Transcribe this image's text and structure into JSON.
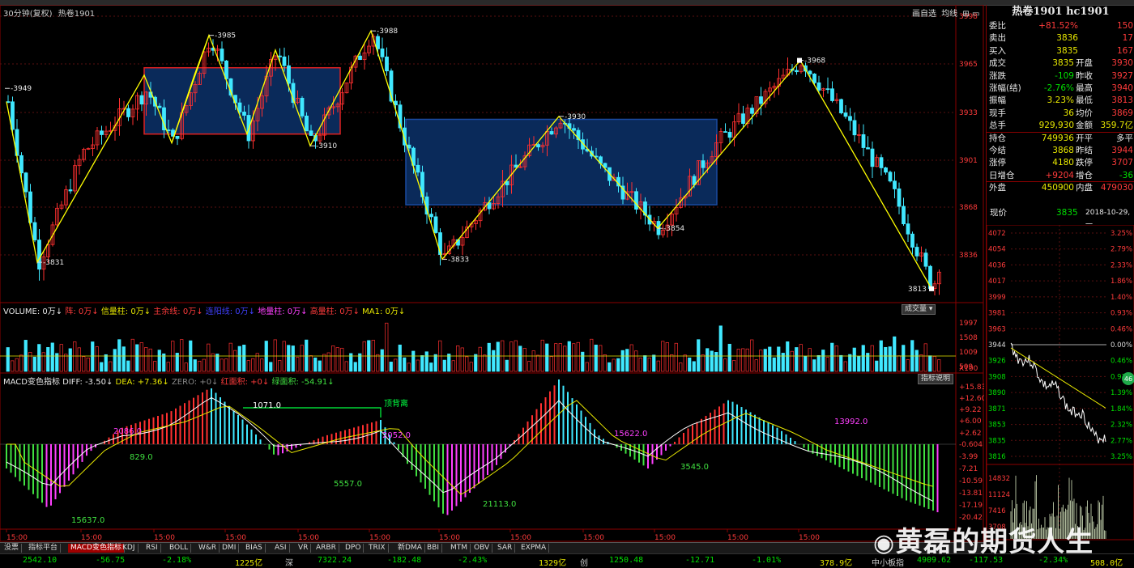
{
  "chart_data": {
    "type": "candlestick",
    "header": {
      "period": "30分钟(复权)",
      "symbol": "热卷1901"
    },
    "price_axis": [
      3998,
      3965,
      3933,
      3901,
      3868,
      3836
    ],
    "volume_axis": [
      1997,
      1508,
      1009,
      509
    ],
    "volume_unit": "X100",
    "macd_axis": [
      "+15.83",
      "+12.60",
      "+9.22",
      "+6.00",
      "+2.62",
      "-0.604",
      "-3.99",
      "-7.21",
      "-10.59",
      "-13.81",
      "-17.19",
      "-20.42"
    ],
    "swing_points": [
      {
        "label": "3949"
      },
      {
        "label": "3831"
      },
      {
        "label": "3985"
      },
      {
        "label": "3988"
      },
      {
        "label": "3910"
      },
      {
        "label": "3833"
      },
      {
        "label": "3930"
      },
      {
        "label": "3854"
      },
      {
        "label": "3968"
      },
      {
        "label": "3813"
      }
    ],
    "macd_labels": [
      "2086.0",
      "829.0",
      "1071.0",
      "2052.0",
      "15637.0",
      "5557.0",
      "21113.0",
      "15622.0",
      "3545.0",
      "13992.0"
    ],
    "annotation": "顶背离",
    "x_ticks": [
      "15:00",
      "15:00",
      "15:00",
      "15:00",
      "15:00",
      "15:00",
      "15:00",
      "15:00",
      "15:00",
      "15:00",
      "15:00",
      "15:00"
    ],
    "volume_legend": [
      "VOLUME: 0万",
      "阵: 0万",
      "信量柱: 0万",
      "主余线: 0万",
      "连阳线: 0万",
      "地量柱: 0万",
      "高量柱: 0万",
      "MA1: 0万"
    ],
    "macd_legend": [
      "MACD变色指标 DIFF: -3.50",
      "DEA: +7.36",
      "ZERO: +0",
      "红面积: +0",
      "绿面积: -54.91"
    ]
  },
  "chart_controls": {
    "tools": "画自选",
    "avg": "均线",
    "vol_btn": "成交量",
    "ind_btn": "指标说明"
  },
  "quote": {
    "title": "热卷1901 hc1901",
    "rows": [
      {
        "k": "委比",
        "v": "+81.52%",
        "v2": "150"
      },
      {
        "k": "卖出",
        "v": "3836",
        "v2": "17"
      },
      {
        "k": "买入",
        "v": "3835",
        "v2": "167"
      },
      {
        "k": "成交",
        "v": "3835",
        "k2": "开盘",
        "v2": "3930"
      },
      {
        "k": "涨跌",
        "v": "-109",
        "k2": "昨收",
        "v2": "3927"
      },
      {
        "k": "涨幅(结)",
        "v": "-2.76%",
        "k2": "最高",
        "v2": "3940"
      },
      {
        "k": "振幅",
        "v": "3.23%",
        "k2": "最低",
        "v2": "3813"
      },
      {
        "k": "现手",
        "v": "36",
        "k2": "均价",
        "v2": "3869"
      },
      {
        "k": "总手",
        "v": "929,930",
        "k2": "金额",
        "v2": "359.7亿"
      },
      {
        "k": "持仓",
        "v": "749936",
        "k2": "开平",
        "v2": "多平"
      },
      {
        "k": "今结",
        "v": "3868",
        "k2": "昨结",
        "v2": "3944"
      },
      {
        "k": "涨停",
        "v": "4180",
        "k2": "跌停",
        "v2": "3707"
      },
      {
        "k": "日增仓",
        "v": "+9204",
        "k2": "增仓",
        "v2": "-36"
      },
      {
        "k": "外盘",
        "v": "450900",
        "k2": "内盘",
        "v2": "479030"
      }
    ],
    "now_label": "现价",
    "now_price": "3835",
    "date": "2018-10-29,一"
  },
  "minichart": {
    "left_axis": [
      "4072",
      "4054",
      "4036",
      "4017",
      "3999",
      "3981",
      "3963",
      "3944",
      "3926",
      "3908",
      "3890",
      "3871",
      "3853",
      "3835",
      "3816"
    ],
    "right_axis": [
      "3.25%",
      "2.79%",
      "2.33%",
      "1.86%",
      "1.40%",
      "0.93%",
      "0.46%",
      "0.00%",
      "0.46%",
      "0.93%",
      "1.39%",
      "1.84%",
      "2.32%",
      "2.77%",
      "3.25%"
    ],
    "vol_axis": [
      "14832",
      "11124",
      "7416",
      "3708"
    ],
    "badge": "46"
  },
  "tabs": [
    "没票",
    "指标平台",
    "MACD变色指标",
    "KDJ",
    "RSI",
    "BOLL",
    "W&R",
    "DMI",
    "BIAS",
    "ASI",
    "VR",
    "ARBR",
    "DPO",
    "TRIX",
    "新DMA",
    "BBI",
    "MTM",
    "OBV",
    "SAR",
    "EXPMA"
  ],
  "index_bar": [
    {
      "v": "2542.10",
      "c": "#00e000"
    },
    {
      "v": "-56.75",
      "c": "#00e000"
    },
    {
      "v": "-2.18%",
      "c": "#00e000"
    },
    {
      "v": "1225亿",
      "c": "#e8e800"
    },
    {
      "v": "深",
      "c": "#ccc"
    },
    {
      "v": "7322.24",
      "c": "#00e000"
    },
    {
      "v": "-182.48",
      "c": "#00e000"
    },
    {
      "v": "-2.43%",
      "c": "#00e000"
    },
    {
      "v": "1329亿",
      "c": "#e8e800"
    },
    {
      "v": "创",
      "c": "#ccc"
    },
    {
      "v": "1250.48",
      "c": "#00e000"
    },
    {
      "v": "-12.71",
      "c": "#00e000"
    },
    {
      "v": "-1.01%",
      "c": "#00e000"
    },
    {
      "v": "378.9亿",
      "c": "#e8e800"
    },
    {
      "v": "中小板指",
      "c": "#ccc"
    },
    {
      "v": "4909.62",
      "c": "#00e000"
    },
    {
      "v": "-117.53",
      "c": "#00e000"
    },
    {
      "v": "-2.34%",
      "c": "#00e000"
    },
    {
      "v": "508.0亿",
      "c": "#e8e800"
    }
  ],
  "watermark": "黄磊的期货人生"
}
